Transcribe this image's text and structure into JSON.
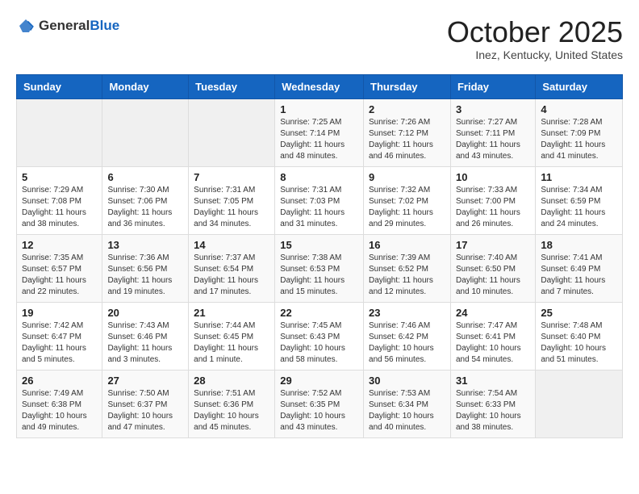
{
  "header": {
    "logo_general": "General",
    "logo_blue": "Blue",
    "title": "October 2025",
    "subtitle": "Inez, Kentucky, United States"
  },
  "days_of_week": [
    "Sunday",
    "Monday",
    "Tuesday",
    "Wednesday",
    "Thursday",
    "Friday",
    "Saturday"
  ],
  "weeks": [
    [
      {
        "day": "",
        "info": ""
      },
      {
        "day": "",
        "info": ""
      },
      {
        "day": "",
        "info": ""
      },
      {
        "day": "1",
        "info": "Sunrise: 7:25 AM\nSunset: 7:14 PM\nDaylight: 11 hours\nand 48 minutes."
      },
      {
        "day": "2",
        "info": "Sunrise: 7:26 AM\nSunset: 7:12 PM\nDaylight: 11 hours\nand 46 minutes."
      },
      {
        "day": "3",
        "info": "Sunrise: 7:27 AM\nSunset: 7:11 PM\nDaylight: 11 hours\nand 43 minutes."
      },
      {
        "day": "4",
        "info": "Sunrise: 7:28 AM\nSunset: 7:09 PM\nDaylight: 11 hours\nand 41 minutes."
      }
    ],
    [
      {
        "day": "5",
        "info": "Sunrise: 7:29 AM\nSunset: 7:08 PM\nDaylight: 11 hours\nand 38 minutes."
      },
      {
        "day": "6",
        "info": "Sunrise: 7:30 AM\nSunset: 7:06 PM\nDaylight: 11 hours\nand 36 minutes."
      },
      {
        "day": "7",
        "info": "Sunrise: 7:31 AM\nSunset: 7:05 PM\nDaylight: 11 hours\nand 34 minutes."
      },
      {
        "day": "8",
        "info": "Sunrise: 7:31 AM\nSunset: 7:03 PM\nDaylight: 11 hours\nand 31 minutes."
      },
      {
        "day": "9",
        "info": "Sunrise: 7:32 AM\nSunset: 7:02 PM\nDaylight: 11 hours\nand 29 minutes."
      },
      {
        "day": "10",
        "info": "Sunrise: 7:33 AM\nSunset: 7:00 PM\nDaylight: 11 hours\nand 26 minutes."
      },
      {
        "day": "11",
        "info": "Sunrise: 7:34 AM\nSunset: 6:59 PM\nDaylight: 11 hours\nand 24 minutes."
      }
    ],
    [
      {
        "day": "12",
        "info": "Sunrise: 7:35 AM\nSunset: 6:57 PM\nDaylight: 11 hours\nand 22 minutes."
      },
      {
        "day": "13",
        "info": "Sunrise: 7:36 AM\nSunset: 6:56 PM\nDaylight: 11 hours\nand 19 minutes."
      },
      {
        "day": "14",
        "info": "Sunrise: 7:37 AM\nSunset: 6:54 PM\nDaylight: 11 hours\nand 17 minutes."
      },
      {
        "day": "15",
        "info": "Sunrise: 7:38 AM\nSunset: 6:53 PM\nDaylight: 11 hours\nand 15 minutes."
      },
      {
        "day": "16",
        "info": "Sunrise: 7:39 AM\nSunset: 6:52 PM\nDaylight: 11 hours\nand 12 minutes."
      },
      {
        "day": "17",
        "info": "Sunrise: 7:40 AM\nSunset: 6:50 PM\nDaylight: 11 hours\nand 10 minutes."
      },
      {
        "day": "18",
        "info": "Sunrise: 7:41 AM\nSunset: 6:49 PM\nDaylight: 11 hours\nand 7 minutes."
      }
    ],
    [
      {
        "day": "19",
        "info": "Sunrise: 7:42 AM\nSunset: 6:47 PM\nDaylight: 11 hours\nand 5 minutes."
      },
      {
        "day": "20",
        "info": "Sunrise: 7:43 AM\nSunset: 6:46 PM\nDaylight: 11 hours\nand 3 minutes."
      },
      {
        "day": "21",
        "info": "Sunrise: 7:44 AM\nSunset: 6:45 PM\nDaylight: 11 hours\nand 1 minute."
      },
      {
        "day": "22",
        "info": "Sunrise: 7:45 AM\nSunset: 6:43 PM\nDaylight: 10 hours\nand 58 minutes."
      },
      {
        "day": "23",
        "info": "Sunrise: 7:46 AM\nSunset: 6:42 PM\nDaylight: 10 hours\nand 56 minutes."
      },
      {
        "day": "24",
        "info": "Sunrise: 7:47 AM\nSunset: 6:41 PM\nDaylight: 10 hours\nand 54 minutes."
      },
      {
        "day": "25",
        "info": "Sunrise: 7:48 AM\nSunset: 6:40 PM\nDaylight: 10 hours\nand 51 minutes."
      }
    ],
    [
      {
        "day": "26",
        "info": "Sunrise: 7:49 AM\nSunset: 6:38 PM\nDaylight: 10 hours\nand 49 minutes."
      },
      {
        "day": "27",
        "info": "Sunrise: 7:50 AM\nSunset: 6:37 PM\nDaylight: 10 hours\nand 47 minutes."
      },
      {
        "day": "28",
        "info": "Sunrise: 7:51 AM\nSunset: 6:36 PM\nDaylight: 10 hours\nand 45 minutes."
      },
      {
        "day": "29",
        "info": "Sunrise: 7:52 AM\nSunset: 6:35 PM\nDaylight: 10 hours\nand 43 minutes."
      },
      {
        "day": "30",
        "info": "Sunrise: 7:53 AM\nSunset: 6:34 PM\nDaylight: 10 hours\nand 40 minutes."
      },
      {
        "day": "31",
        "info": "Sunrise: 7:54 AM\nSunset: 6:33 PM\nDaylight: 10 hours\nand 38 minutes."
      },
      {
        "day": "",
        "info": ""
      }
    ]
  ]
}
